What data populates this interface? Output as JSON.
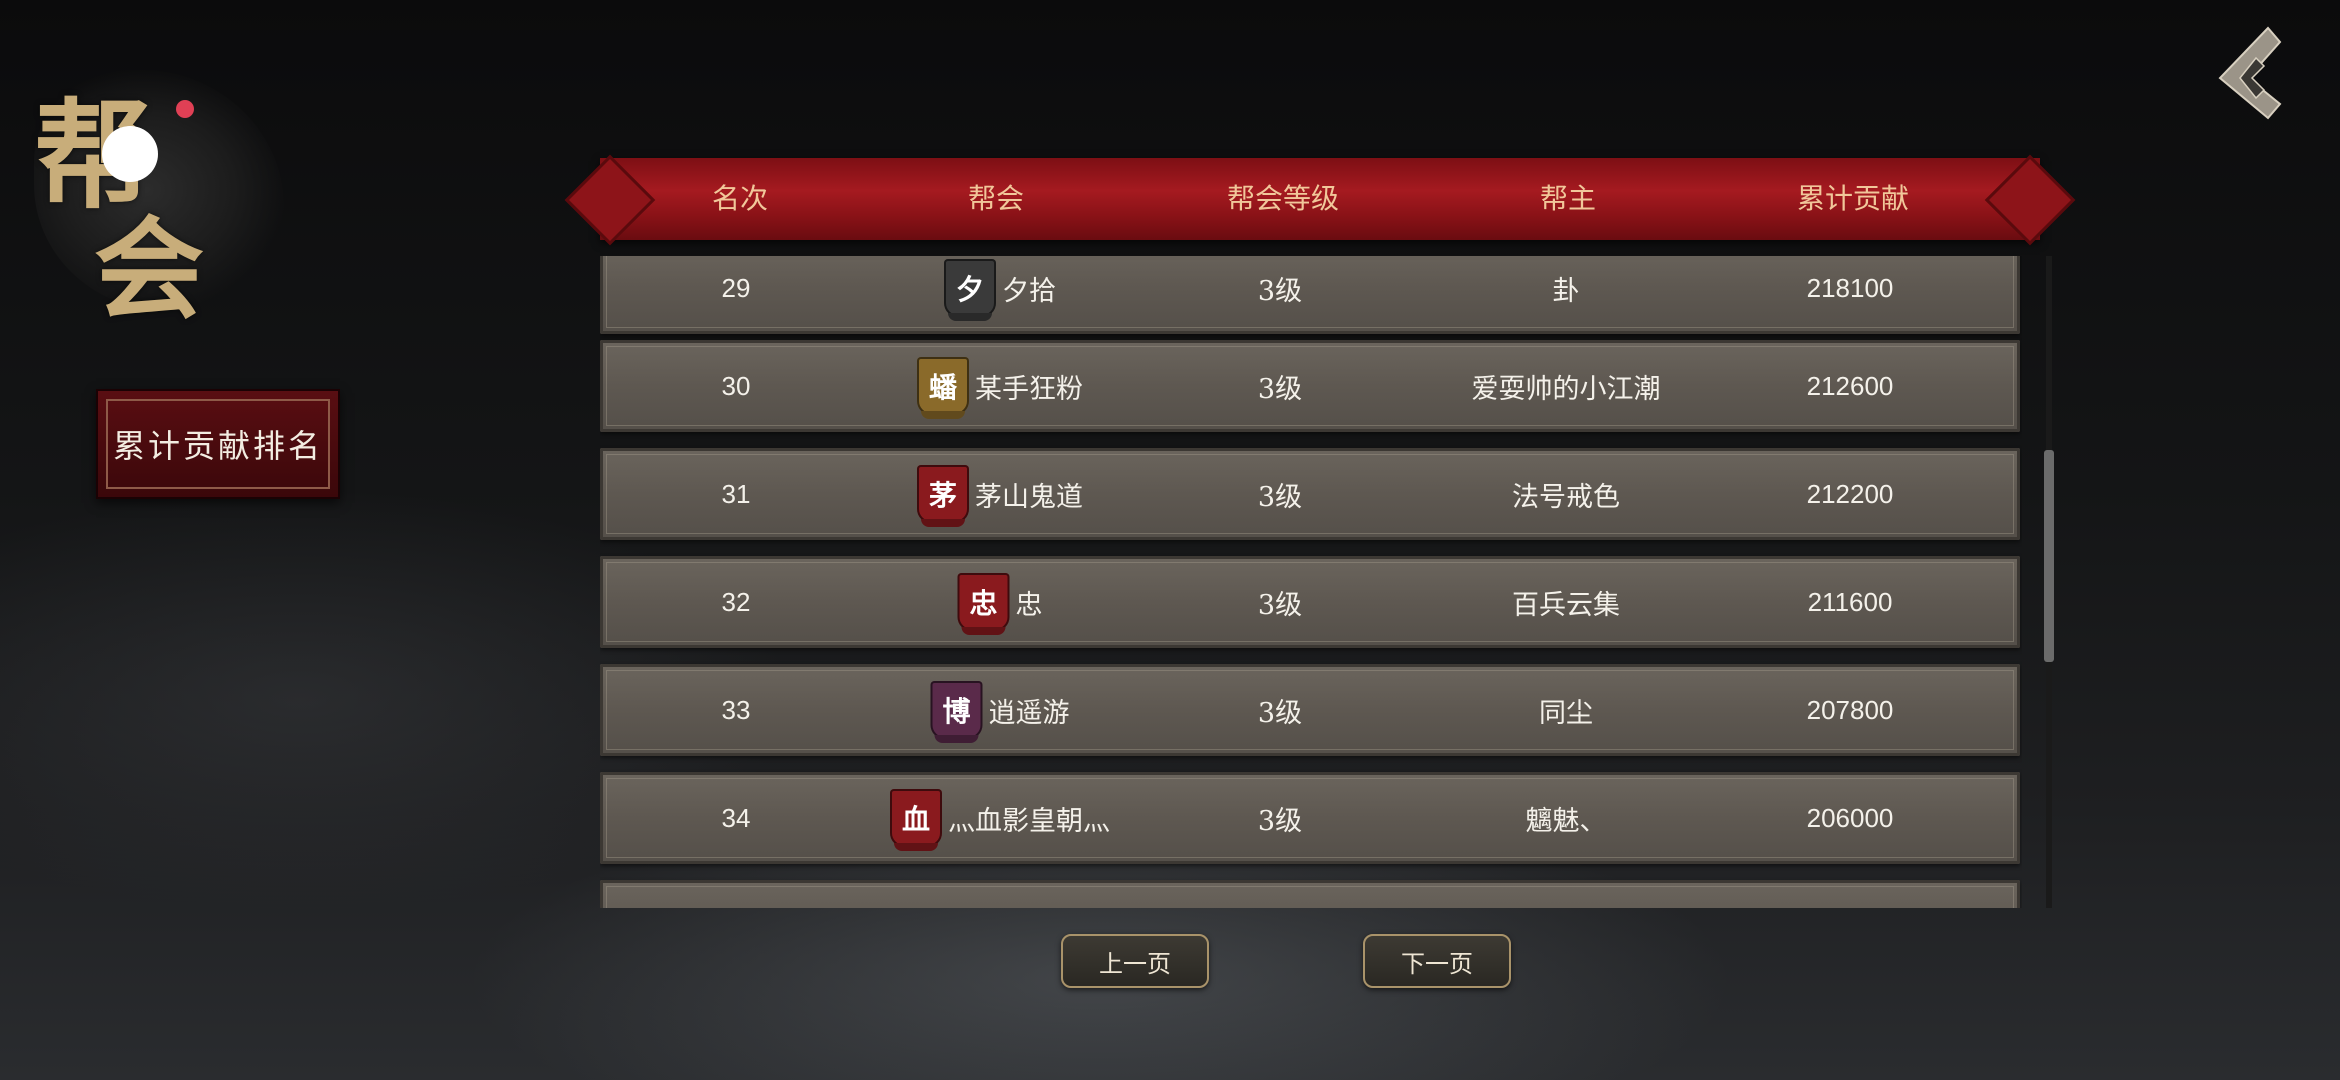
{
  "title_emblem": {
    "char1": "帮",
    "char2": "会"
  },
  "side_tab": {
    "label": "累计贡献排名"
  },
  "table": {
    "headers": [
      "名次",
      "帮会",
      "帮会等级",
      "帮主",
      "累计贡献"
    ],
    "rows": [
      {
        "rank": "29",
        "icon_char": "夕",
        "icon_color": "#3a3a3a",
        "guild": "夕拾",
        "level": "3级",
        "leader": "卦",
        "contribution": "218100"
      },
      {
        "rank": "30",
        "icon_char": "蟠",
        "icon_color": "#8a6a2a",
        "guild": "某手狂粉",
        "level": "3级",
        "leader": "爱耍帅的小江潮",
        "contribution": "212600"
      },
      {
        "rank": "31",
        "icon_char": "茅",
        "icon_color": "#8a1a1e",
        "guild": "茅山鬼道",
        "level": "3级",
        "leader": "法号戒色",
        "contribution": "212200"
      },
      {
        "rank": "32",
        "icon_char": "忠",
        "icon_color": "#8a1a1e",
        "guild": "忠",
        "level": "3级",
        "leader": "百兵云集",
        "contribution": "211600"
      },
      {
        "rank": "33",
        "icon_char": "博",
        "icon_color": "#5a2a4a",
        "guild": "逍遥游",
        "level": "3级",
        "leader": "同尘",
        "contribution": "207800"
      },
      {
        "rank": "34",
        "icon_char": "血",
        "icon_color": "#8a1a1e",
        "guild": "灬血影皇朝灬",
        "level": "3级",
        "leader": "魑魅、",
        "contribution": "206000"
      }
    ]
  },
  "pager": {
    "prev": "上一页",
    "next": "下一页"
  },
  "scroll_position": 0.44
}
